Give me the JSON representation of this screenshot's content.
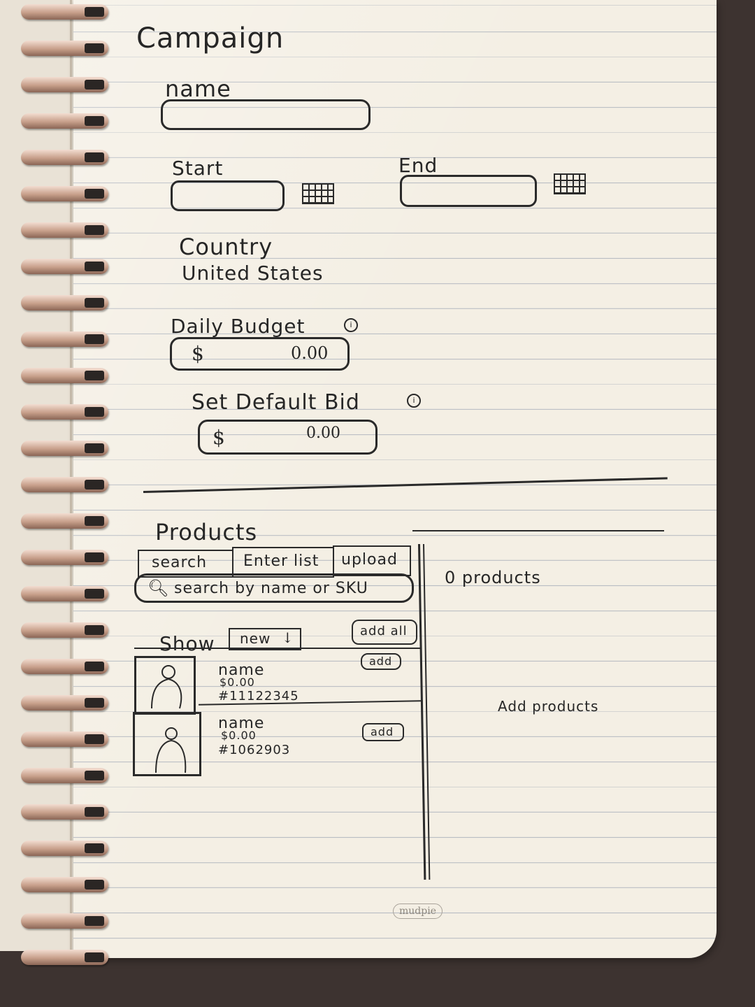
{
  "campaign": {
    "title": "Campaign",
    "name_label": "name",
    "start_label": "Start",
    "end_label": "End",
    "country_label": "Country",
    "country_value": "United States",
    "daily_budget_label": "Daily Budget",
    "daily_budget_currency": "$",
    "daily_budget_value": "0.00",
    "default_bid_label": "Set Default Bid",
    "default_bid_currency": "$",
    "default_bid_value": "0.00"
  },
  "products": {
    "title": "Products",
    "tabs": [
      {
        "label": "search"
      },
      {
        "label": "Enter list"
      },
      {
        "label": "upload"
      }
    ],
    "search_placeholder": "search by name or SKU",
    "show_label": "Show",
    "sort_value": "new",
    "add_all_label": "add all",
    "items": [
      {
        "name": "name",
        "price": "$0.00",
        "sku": "#11122345",
        "add_label": "add"
      },
      {
        "name": "name",
        "price": "$0.00",
        "sku": "#1062903",
        "add_label": "add"
      }
    ],
    "selected_count": "0 products",
    "empty_state": "Add products"
  },
  "notebook": {
    "brand": "mudpie"
  }
}
